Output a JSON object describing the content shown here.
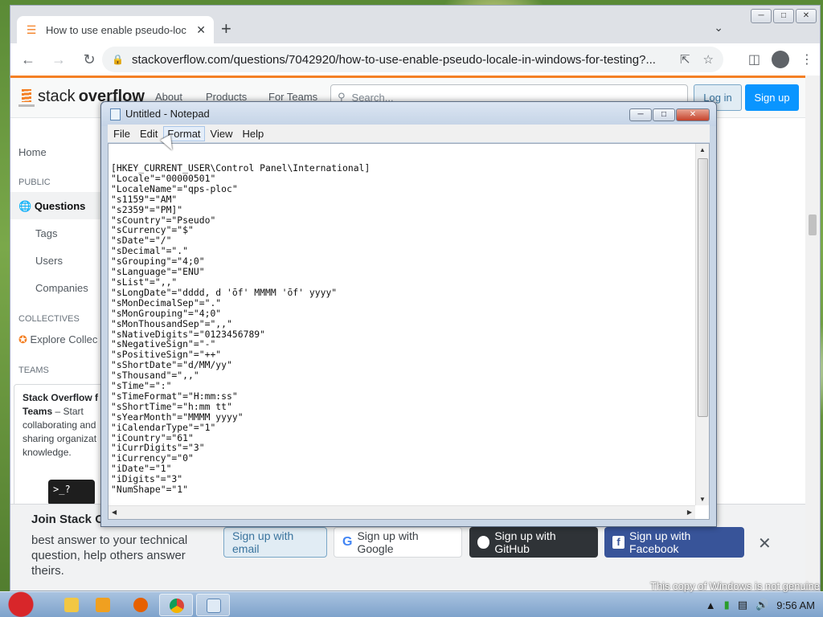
{
  "browser": {
    "tab_title": "How to use enable pseudo-loc",
    "url": "stackoverflow.com/questions/7042920/how-to-use-enable-pseudo-locale-in-windows-for-testing?..."
  },
  "so": {
    "logo_text_plain": "stack",
    "logo_text_bold": "overflow",
    "nav": [
      "About",
      "Products",
      "For Teams"
    ],
    "search_placeholder": "Search...",
    "login": "Log in",
    "signup": "Sign up",
    "sidebar": {
      "home": "Home",
      "public": "PUBLIC",
      "questions": "Questions",
      "tags": "Tags",
      "users": "Users",
      "companies": "Companies",
      "collectives": "COLLECTIVES",
      "explore": "Explore Collec",
      "teams": "TEAMS"
    },
    "teams_box": {
      "title": "Stack Overflow f",
      "title2": "Teams",
      "body": " – Start collaborating and sharing organizat knowledge.",
      "illus": ">_?"
    },
    "join": {
      "title": "Join Stack O",
      "text": "best answer to your technical question, help others answer theirs.",
      "email": "Sign up with email",
      "google": "Sign up with Google",
      "github": "Sign up with GitHub",
      "facebook": "Sign up with Facebook"
    }
  },
  "notepad": {
    "title": "Untitled - Notepad",
    "menu": [
      "File",
      "Edit",
      "Format",
      "View",
      "Help"
    ],
    "lines": [
      "[HKEY_CURRENT_USER\\Control Panel\\International]",
      "\"Locale\"=\"00000501\"",
      "\"LocaleName\"=\"qps-ploc\"",
      "\"s1159\"=\"AM\"",
      "\"s2359\"=\"PM]\"",
      "\"sCountry\"=\"Pseudo\"",
      "\"sCurrency\"=\"$\"",
      "\"sDate\"=\"/\"",
      "\"sDecimal\"=\".\"",
      "\"sGrouping\"=\"4;0\"",
      "\"sLanguage\"=\"ENU\"",
      "\"sList\"=\",,\"",
      "\"sLongDate\"=\"dddd, d 'ōf' MMMM 'ōf' yyyy\"",
      "\"sMonDecimalSep\"=\".\"",
      "\"sMonGrouping\"=\"4;0\"",
      "\"sMonThousandSep\"=\",,\"",
      "\"sNativeDigits\"=\"0123456789\"",
      "\"sNegativeSign\"=\"-\"",
      "\"sPositiveSign\"=\"++\"",
      "\"sShortDate\"=\"d/MM/yy\"",
      "\"sThousand\"=\",,\"",
      "\"sTime\"=\":\"",
      "\"sTimeFormat\"=\"H:mm:ss\"",
      "\"sShortTime\"=\"h:mm tt\"",
      "\"sYearMonth\"=\"MMMM yyyy\"",
      "\"iCalendarType\"=\"1\"",
      "\"iCountry\"=\"61\"",
      "\"iCurrDigits\"=\"3\"",
      "\"iCurrency\"=\"0\"",
      "\"iDate\"=\"1\"",
      "\"iDigits\"=\"3\"",
      "\"NumShape\"=\"1\""
    ]
  },
  "taskbar": {
    "time": "9:56 AM",
    "watermark": "This copy of Windows is not genuine"
  },
  "colors": {
    "so_orange": "#f48024",
    "so_blue": "#0a95ff",
    "facebook": "#385499",
    "github": "#2f3337"
  },
  "icons": [
    "stackoverflow-favicon",
    "close-icon",
    "plus-icon",
    "back-icon",
    "forward-icon",
    "reload-icon",
    "lock-icon",
    "share-icon",
    "star-icon",
    "sidebar-icon",
    "profile-icon",
    "menu-icon",
    "search-icon",
    "globe-icon",
    "collectives-icon",
    "google-icon",
    "github-icon",
    "facebook-icon",
    "notepad-icon"
  ]
}
